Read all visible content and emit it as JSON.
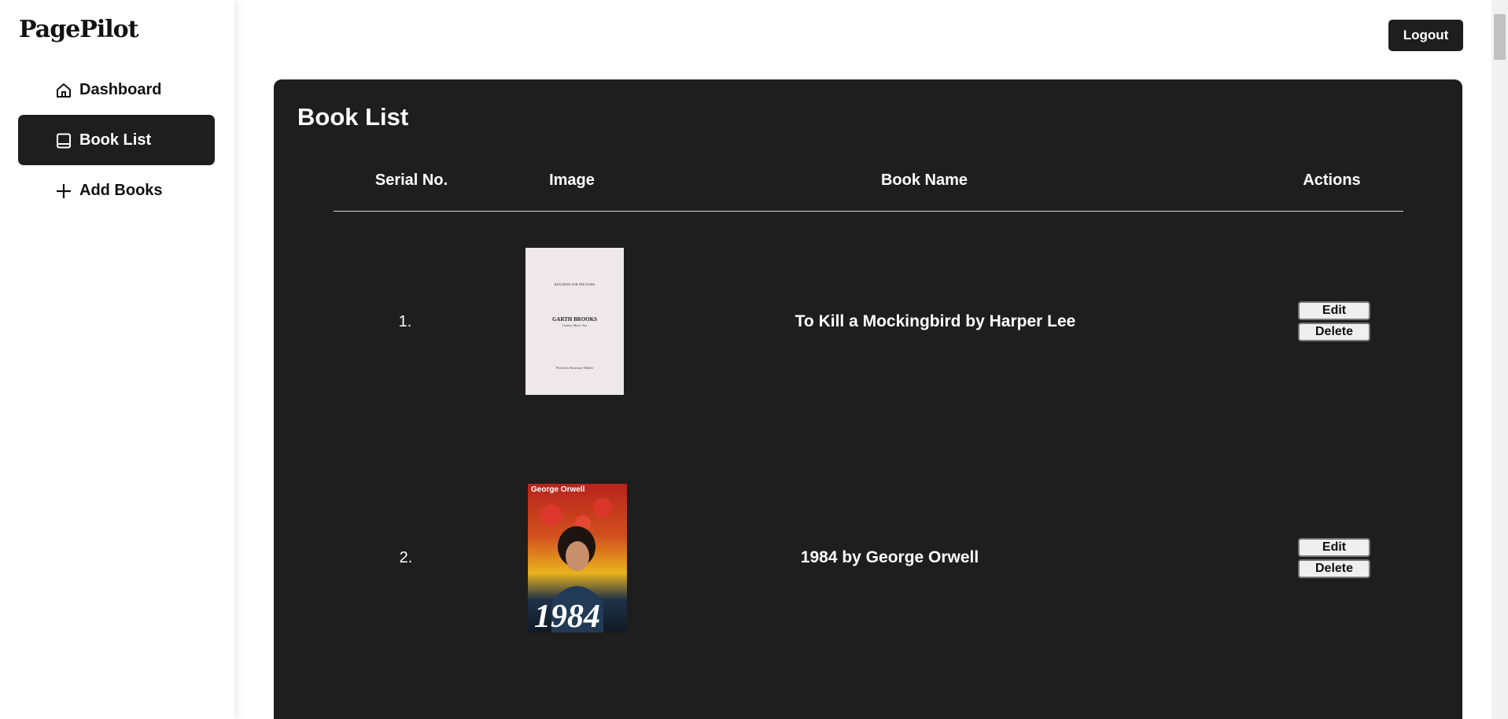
{
  "app": {
    "brand": "PagePilot"
  },
  "sidebar": {
    "items": [
      {
        "label": "Dashboard",
        "icon": "home-icon",
        "active": false
      },
      {
        "label": "Book List",
        "icon": "book-icon",
        "active": true
      },
      {
        "label": "Add Books",
        "icon": "plus-icon",
        "active": false
      }
    ]
  },
  "header": {
    "logout_label": "Logout"
  },
  "main": {
    "title": "Book List",
    "columns": [
      "Serial No.",
      "Image",
      "Book Name",
      "Actions"
    ],
    "rows": [
      {
        "serial": "1.",
        "name": "To Kill a Mockingbird by Harper Lee",
        "cover": {
          "top_text": "REACHING FOR THE STARS",
          "title": "GARTH BROOKS",
          "subtitle": "Country Music Star",
          "bottom_text": "Written by Rosemary Wallner"
        },
        "edit_label": "Edit",
        "delete_label": "Delete"
      },
      {
        "serial": "2.",
        "name": "1984 by George Orwell",
        "cover": {
          "author": "George Orwell",
          "title": "1984"
        },
        "edit_label": "Edit",
        "delete_label": "Delete"
      }
    ]
  },
  "colors": {
    "panel": "#1e1e1e",
    "accent_dark": "#1e1e1e",
    "text_light": "#ffffff"
  }
}
